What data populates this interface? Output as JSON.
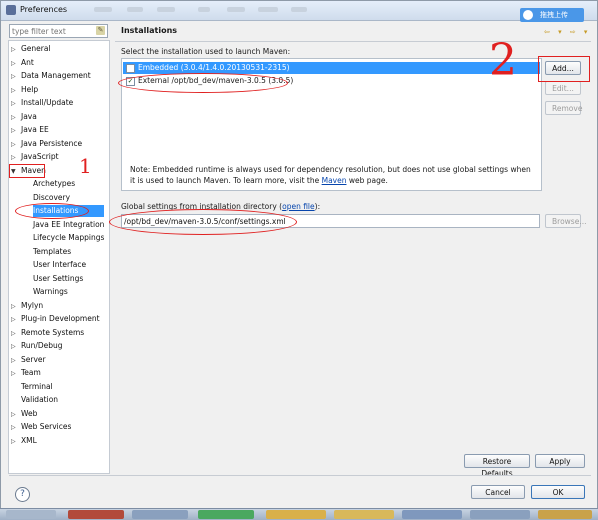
{
  "window": {
    "title": "Preferences"
  },
  "overlay": {
    "upload_label": "拖拽上传"
  },
  "filter": {
    "placeholder": "type filter text",
    "clear_icon": "clear-filter-icon"
  },
  "tree": {
    "items": [
      {
        "label": "General",
        "expandable": true
      },
      {
        "label": "Ant",
        "expandable": true
      },
      {
        "label": "Data Management",
        "expandable": true
      },
      {
        "label": "Help",
        "expandable": true
      },
      {
        "label": "Install/Update",
        "expandable": true
      },
      {
        "label": "Java",
        "expandable": true
      },
      {
        "label": "Java EE",
        "expandable": true
      },
      {
        "label": "Java Persistence",
        "expandable": true
      },
      {
        "label": "JavaScript",
        "expandable": true
      },
      {
        "label": "Maven",
        "expandable": true,
        "expanded": true
      },
      {
        "label": "Archetypes",
        "child": true
      },
      {
        "label": "Discovery",
        "child": true
      },
      {
        "label": "Installations",
        "child": true,
        "selected": true
      },
      {
        "label": "Java EE Integration",
        "child": true
      },
      {
        "label": "Lifecycle Mappings",
        "child": true
      },
      {
        "label": "Templates",
        "child": true
      },
      {
        "label": "User Interface",
        "child": true
      },
      {
        "label": "User Settings",
        "child": true
      },
      {
        "label": "Warnings",
        "child": true
      },
      {
        "label": "Mylyn",
        "expandable": true
      },
      {
        "label": "Plug-in Development",
        "expandable": true
      },
      {
        "label": "Remote Systems",
        "expandable": true
      },
      {
        "label": "Run/Debug",
        "expandable": true
      },
      {
        "label": "Server",
        "expandable": true
      },
      {
        "label": "Team",
        "expandable": true
      },
      {
        "label": "Terminal",
        "expandable": false
      },
      {
        "label": "Validation",
        "expandable": false
      },
      {
        "label": "Web",
        "expandable": true
      },
      {
        "label": "Web Services",
        "expandable": true
      },
      {
        "label": "XML",
        "expandable": true
      }
    ]
  },
  "page": {
    "title": "Installations",
    "select_label": "Select the installation used to launch Maven:",
    "installations": [
      {
        "label": "Embedded (3.0.4/1.4.0.20130531-2315)",
        "checked": false,
        "selected": true
      },
      {
        "label": "External /opt/bd_dev/maven-3.0.5 (3.0.5)",
        "checked": true,
        "selected": false
      }
    ],
    "note_prefix": "Note: Embedded runtime is always used for dependency resolution, but does not use global settings when it is used to launch Maven. To learn more, visit the ",
    "note_link": "Maven",
    "note_suffix": " web page.",
    "global_label_prefix": "Global settings from installation directory (",
    "global_link": "open file",
    "global_label_suffix": "):",
    "global_settings_path": "/opt/bd_dev/maven-3.0.5/conf/settings.xml"
  },
  "buttons": {
    "add": "Add...",
    "edit": "Edit...",
    "remove": "Remove",
    "browse": "Browse...",
    "restore_defaults": "Restore Defaults",
    "apply": "Apply",
    "cancel": "Cancel",
    "ok": "OK"
  },
  "annotations": {
    "mark_1": "1",
    "mark_2": "2"
  },
  "colors": {
    "selection": "#3399ff",
    "annotation": "#e02020",
    "link": "#0645ad"
  }
}
